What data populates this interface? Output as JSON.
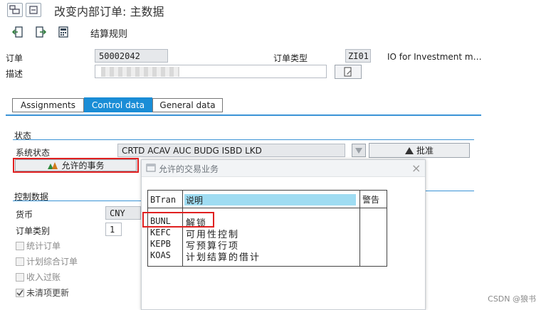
{
  "window": {
    "title": "改变内部订单: 主数据"
  },
  "toolbar": {
    "settlement_rule_label": "结算规则"
  },
  "header": {
    "order_label": "订单",
    "order_value": "50002042",
    "order_type_label": "订单类型",
    "order_type_value": "ZI01",
    "order_type_desc": "IO for Investment m…",
    "desc_label": "描述"
  },
  "tabs": [
    {
      "label": "Assignments",
      "active": false
    },
    {
      "label": "Control data",
      "active": true
    },
    {
      "label": "General data",
      "active": false
    }
  ],
  "status_section": {
    "title": "状态",
    "system_status_label": "系统状态",
    "system_status_value": "CRTD ACAV AUC  BUDG ISBD LKD",
    "approve_label": "批准",
    "allowed_tx_button": "允许的事务"
  },
  "control_section": {
    "title": "控制数据",
    "currency_label": "货币",
    "currency_value": "CNY",
    "order_category_label": "订单类别",
    "order_category_value": "1",
    "checkboxes": [
      {
        "label": "统计订单",
        "checked": false
      },
      {
        "label": "计划综合订单",
        "checked": false
      },
      {
        "label": "收入过账",
        "checked": false
      },
      {
        "label": "未清项更新",
        "checked": true
      }
    ]
  },
  "popup": {
    "title": "允许的交易业务",
    "columns": [
      "BTran",
      "说明",
      "警告"
    ],
    "rows": [
      {
        "code": "BUNL",
        "desc": "解锁"
      },
      {
        "code": "KEFC",
        "desc": "可用性控制"
      },
      {
        "code": "KEPB",
        "desc": "写预算行项"
      },
      {
        "code": "KOAS",
        "desc": "计划结算的借计"
      }
    ]
  },
  "watermark": "CSDN @狼书",
  "colors": {
    "accent": "#1a8dd6",
    "highlight": "#e02020",
    "header_cell": "#9fdcf2"
  }
}
